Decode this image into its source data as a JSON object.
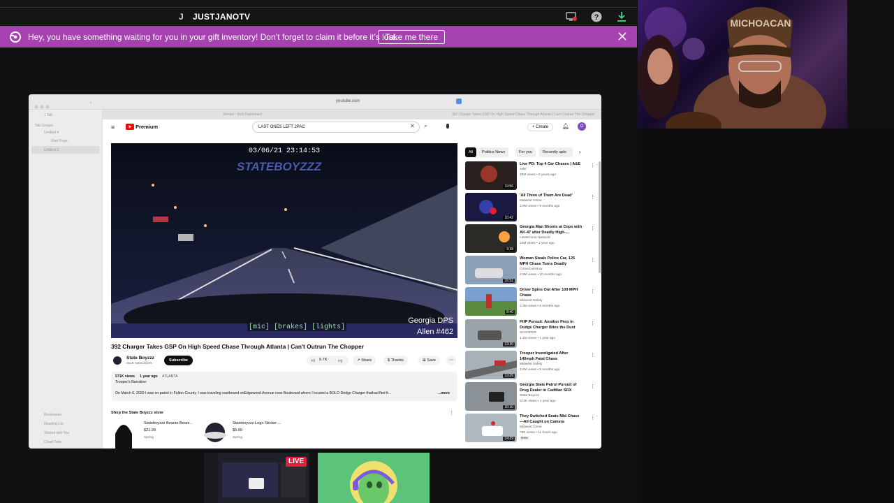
{
  "topbar": {
    "user_initial": "J",
    "user_name": "JUSTJANOTV",
    "icons": [
      "monitor-alert-icon",
      "help-icon",
      "download-icon"
    ]
  },
  "banner": {
    "text": "Hey, you have something waiting for you in your gift inventory! Don’t forget to claim it before it’s lost.",
    "button": "Take me there",
    "color": "#a641b0"
  },
  "browser": {
    "url": "youtube.com",
    "sidebar": {
      "tabs_count": "1 Tab",
      "section": "Tab Groups",
      "groups": [
        "Untitled 4",
        "Start Page",
        "Untitled 5"
      ],
      "bottom": [
        "Bookmarks",
        "Reading List",
        "Shared with You",
        "Cloud Tabs"
      ]
    },
    "tab_left": "Stream - Kick Dashboard",
    "tab_right": "392 Charger Takes GSP On High Speed Chase Through Atlanta | Can't Outrun The Chopper"
  },
  "youtube": {
    "logo": "Premium",
    "search": "LAST ONES LEFT 2PAC",
    "create": "+ Create",
    "avatar": "O",
    "video": {
      "timestamp": "03/06/21 23:14:53",
      "watermark": "STATEBOYZZZ",
      "caption": "[mic] [brakes] [lights]",
      "agency": "Georgia DPS",
      "unit": "Allen #462",
      "title": "392 Charger Takes GSP On High Speed Chase Through Atlanta | Can't Outrun The Chopper",
      "channel": "State Boyzzz",
      "subs": "311K subscribers",
      "subscribe": "Subscribe",
      "likes": "9.7K",
      "share": "Share",
      "thanks": "Thanks",
      "save": "Save",
      "views": "571K views",
      "age": "1 year ago",
      "tag": "ATLANTA",
      "desc1": "Trooper's Narrative:",
      "desc2": "On March 6, 2020 I was on patrol in Fulton County. I was traveling eastbound onEdgewood Avenue near Boulevard where I located a BOLO Dodge Charger thathad fled fr...",
      "more": "...more",
      "shop_title": "Shop the State Boyzzz store",
      "products": [
        {
          "name": "Stateboyzzz Beanie Beani...",
          "price": "$21.99",
          "store": "Spring"
        },
        {
          "name": "Stateboyzzz Logo Sticker ...",
          "price": "$5.99",
          "store": "Spring"
        }
      ]
    },
    "chips": [
      "All",
      "Politics News",
      "For you",
      "Recently uplo"
    ],
    "suggestions": [
      {
        "title": "Live PD: Top 4 Car Chases | A&E",
        "channel": "A&E",
        "meta": "28M views • 5 years ago",
        "dur": "19:56"
      },
      {
        "title": "'All Three of Them Are Dead'",
        "channel": "Midwest Crime",
        "meta": "2.9M views • 9 months ago",
        "dur": "10:42"
      },
      {
        "title": "Georgia Man Shoots at Cops with AK-47 after Deadly High-...",
        "channel": "Law&Crime Network",
        "meta": "24M views • 1 year ago",
        "dur": "9:38"
      },
      {
        "title": "Woman Steals Police Car, 125 MPH Chase Turns Deadly",
        "channel": "CrimeCamNow",
        "meta": "4.9M views • 10 months ago",
        "dur": "15:52"
      },
      {
        "title": "Driver Spins Out After 109 MPH Chase",
        "channel": "Midwest Safety",
        "meta": "3.3M views • 5 months ago",
        "dur": "8:40"
      },
      {
        "title": "FHP Pursuit: Another Perp in Dodge Charger Bites the Dust",
        "channel": "SCOOPER",
        "meta": "1.1M views • 1 year ago",
        "dur": "13:20"
      },
      {
        "title": "Trooper Investigated After 140mph Fatal Chase",
        "channel": "Midwest Safety",
        "meta": "3.4M views • 5 months ago",
        "dur": "13:26"
      },
      {
        "title": "Georgia State Patrol Pursuit of Drug Dealer in Cadillac SRX",
        "channel": "State Boyzzz",
        "meta": "573K views • 1 year ago",
        "dur": "10:10"
      },
      {
        "title": "They Switched Seats Mid-Chase —All Caught on Camera",
        "channel": "Midwest Crime",
        "meta": "76K views • 11 hours ago",
        "badge": "New",
        "dur": "14:29"
      }
    ]
  },
  "bottom": {
    "live_badge": "LIVE"
  }
}
